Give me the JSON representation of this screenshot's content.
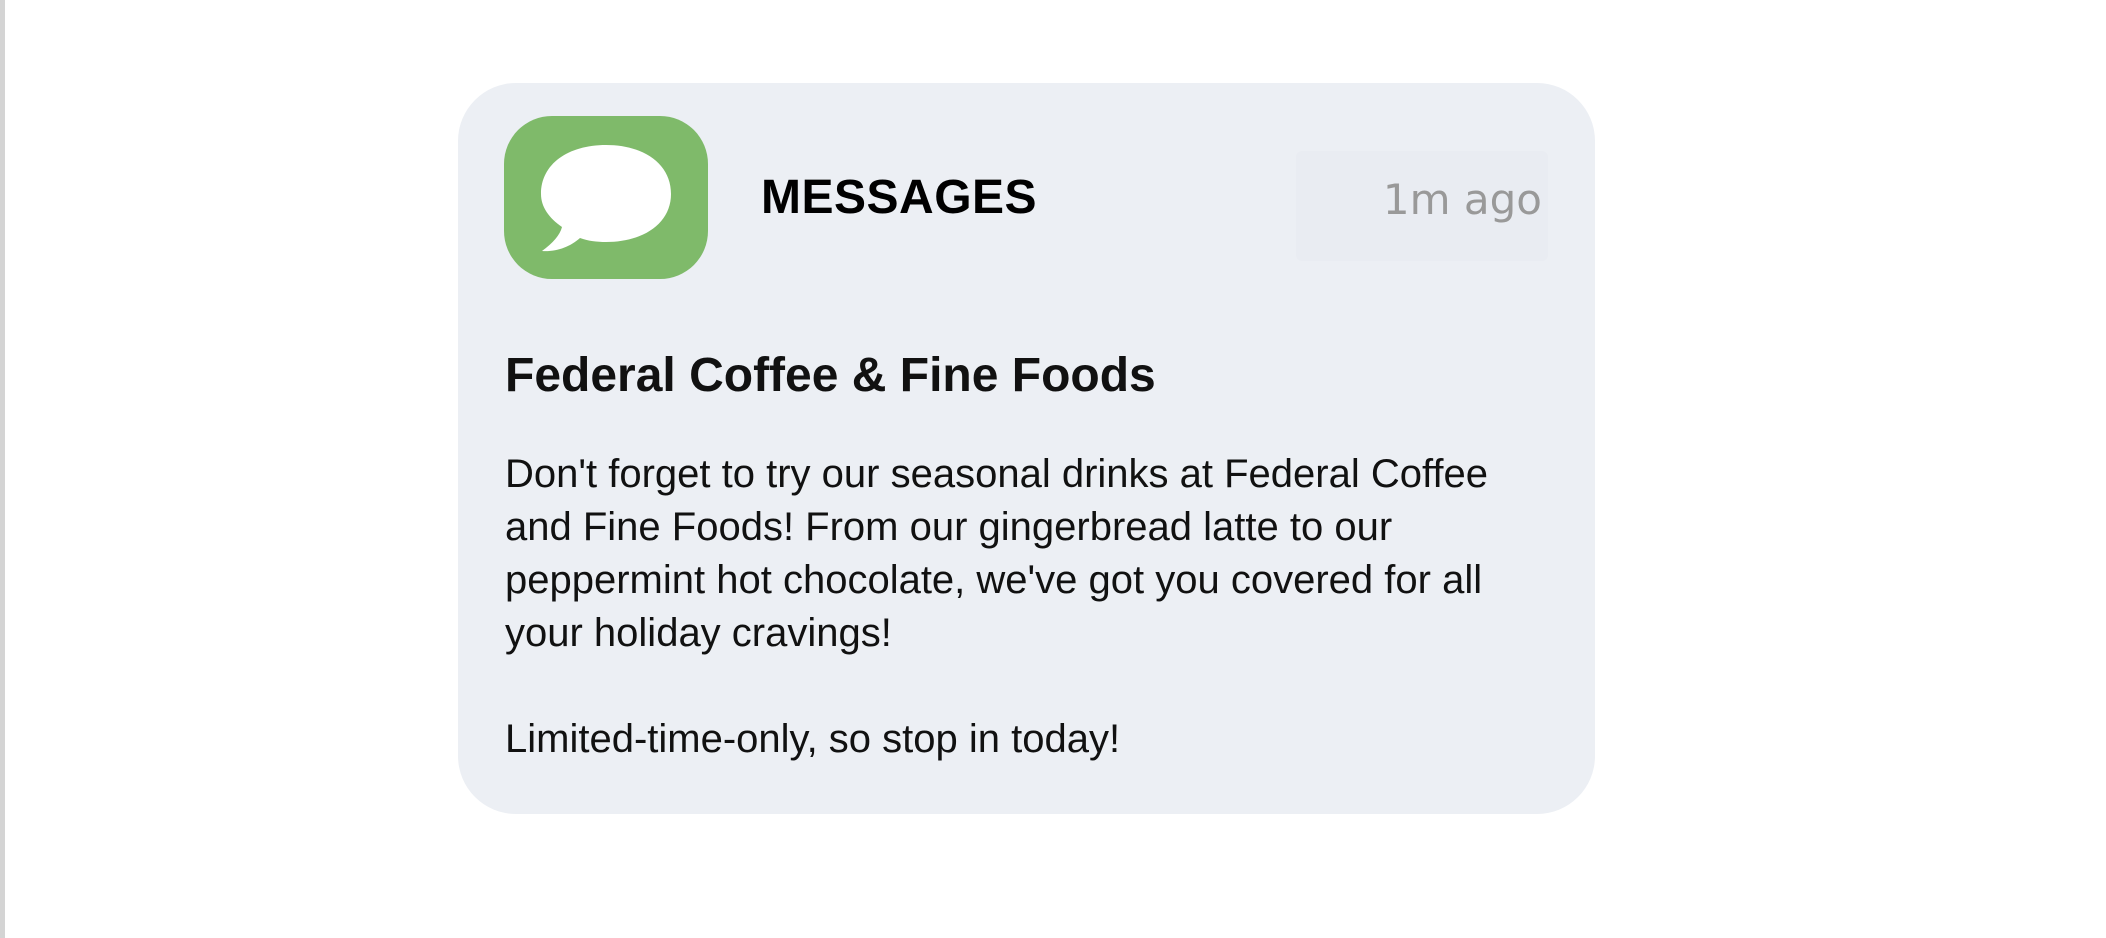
{
  "notification": {
    "app_name": "MESSAGES",
    "timestamp": "1m ago",
    "title": "Federal Coffee & Fine Foods",
    "body_paragraph_1": "Don't forget to try our seasonal drinks at Federal Coffee and Fine Foods! From our gingerbread latte to our peppermint hot chocolate, we've got you covered for all your holiday cravings!",
    "body_paragraph_2": "Limited-time-only, so stop in today!",
    "icon": "messages-icon"
  },
  "colors": {
    "card_background": "#eceff4",
    "icon_background": "#7fba6a",
    "timestamp_text": "#999999"
  }
}
